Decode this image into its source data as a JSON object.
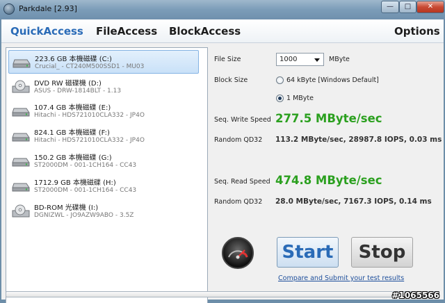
{
  "window": {
    "title": "Parkdale [2.93]",
    "minimize": "—",
    "maximize": "□",
    "close": "✕"
  },
  "tabs": [
    {
      "label": "QuickAccess",
      "active": true
    },
    {
      "label": "FileAccess",
      "active": false
    },
    {
      "label": "BlockAccess",
      "active": false
    },
    {
      "label": "Options",
      "active": false
    }
  ],
  "drives": [
    {
      "name": "223.6 GB 本機磁碟 (C:)",
      "model": "Crucial_ - CT240M500SSD1 - MU03",
      "icon": "hard-drive-icon",
      "selected": true
    },
    {
      "name": "DVD RW 磁碟機 (D:)",
      "model": "ASUS - DRW-1814BLT - 1.13",
      "icon": "optical-drive-icon",
      "selected": false
    },
    {
      "name": "107.4 GB 本機磁碟 (E:)",
      "model": "Hitachi - HDS721010CLA332 - JP4O",
      "icon": "hard-drive-icon",
      "selected": false
    },
    {
      "name": "824.1 GB 本機磁碟 (F:)",
      "model": "Hitachi - HDS721010CLA332 - JP4O",
      "icon": "hard-drive-icon",
      "selected": false
    },
    {
      "name": "150.2 GB 本機磁碟 (G:)",
      "model": "ST2000DM - 001-1CH164 - CC43",
      "icon": "hard-drive-icon",
      "selected": false
    },
    {
      "name": "1712.9 GB 本機磁碟 (H:)",
      "model": "ST2000DM - 001-1CH164 - CC43",
      "icon": "hard-drive-icon",
      "selected": false
    },
    {
      "name": "BD-ROM 光碟機 (I:)",
      "model": "DGNIZWL - JO9AZW9ABO - 3.5Z",
      "icon": "optical-drive-icon",
      "selected": false
    }
  ],
  "settings": {
    "file_size_label": "File Size",
    "file_size_value": "1000",
    "file_size_unit": "MByte",
    "block_size_label": "Block Size",
    "block_options": [
      {
        "label": "64 kByte [Windows Default]",
        "checked": false
      },
      {
        "label": "1 MByte",
        "checked": true
      }
    ]
  },
  "results": {
    "seq_write_label": "Seq. Write Speed",
    "seq_write_value": "277.5 MByte/sec",
    "rand_write_label": "Random QD32",
    "rand_write_value": "113.2 MByte/sec, 28987.8 IOPS, 0.03 ms",
    "seq_read_label": "Seq. Read Speed",
    "seq_read_value": "474.8 MByte/sec",
    "rand_read_label": "Random QD32",
    "rand_read_value": "28.0 MByte/sec, 7167.3 IOPS, 0.14 ms"
  },
  "actions": {
    "start_label": "Start",
    "stop_label": "Stop",
    "submit_link": "Compare and Submit your test results"
  },
  "progress": {
    "value": 0
  },
  "watermark": "#1065566",
  "colors": {
    "accent": "#2a6bb7",
    "speed_green": "#2ba01f",
    "link": "#1d4e9b"
  }
}
